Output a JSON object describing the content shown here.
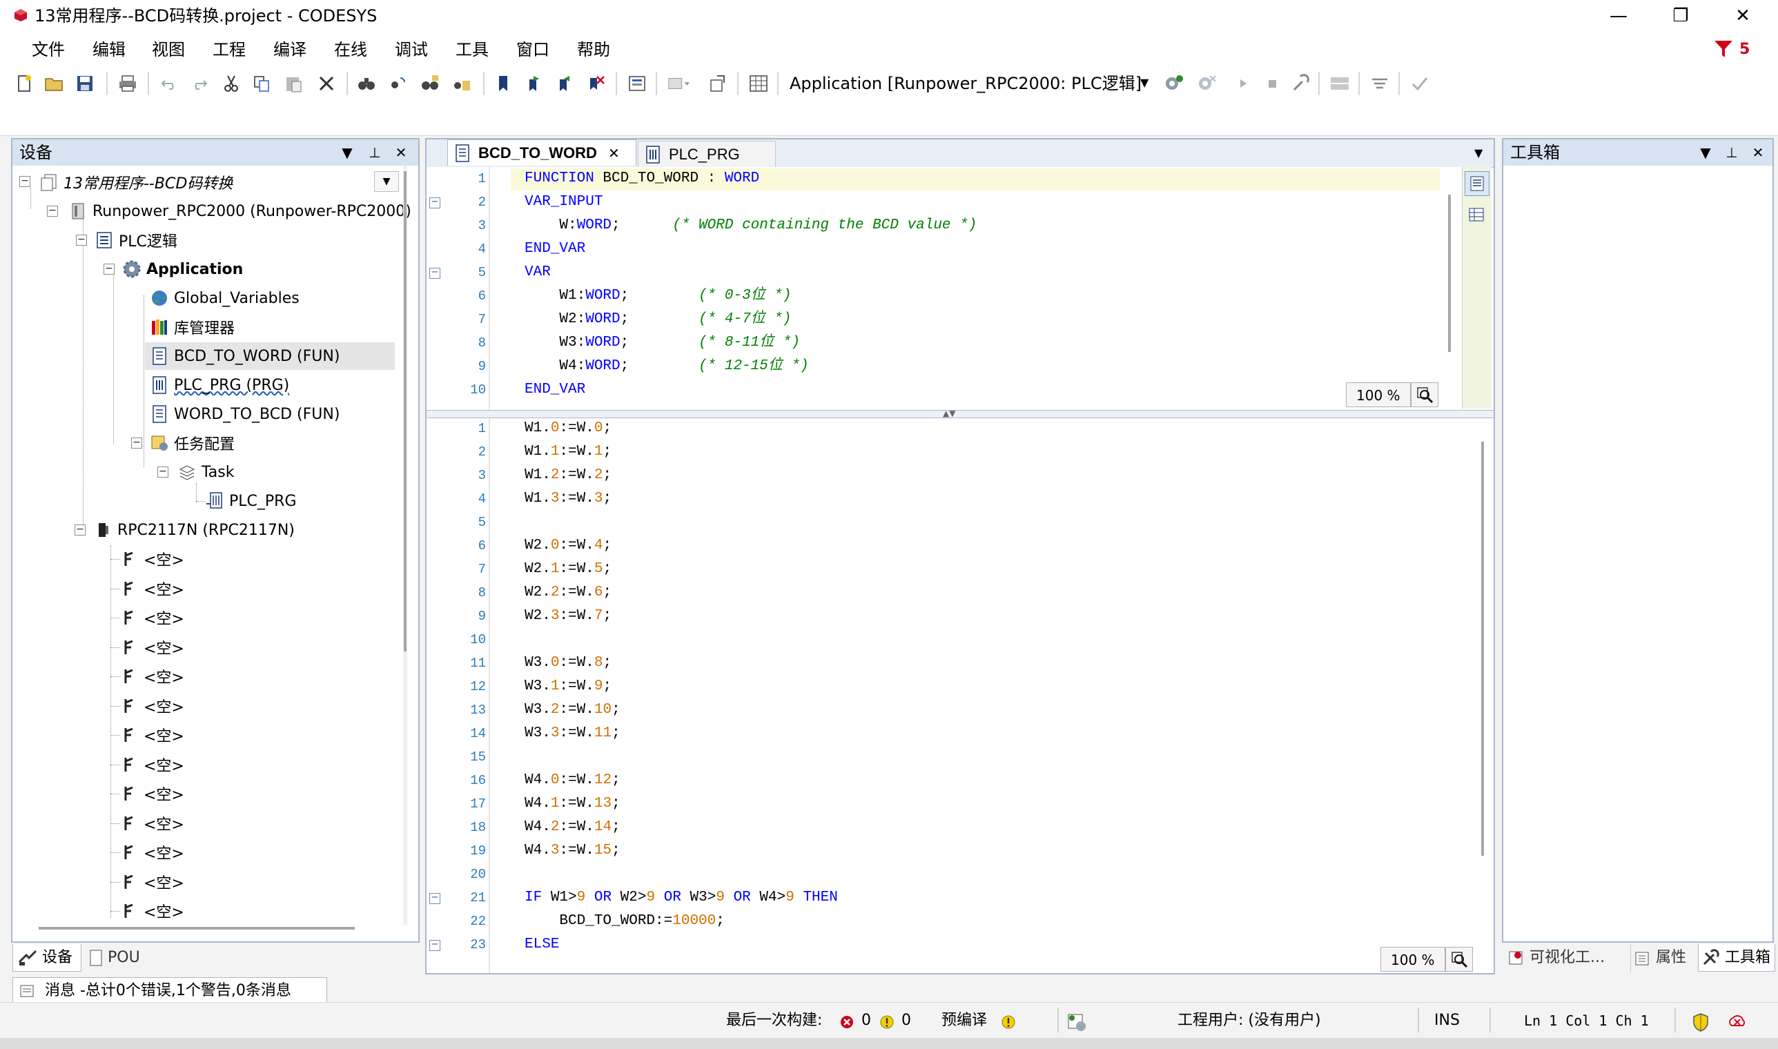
{
  "window": {
    "title": "13常用程序--BCD码转换.project - CODESYS",
    "minimize": "—",
    "restore": "❐",
    "close": "✕",
    "notification_count": "5"
  },
  "menu": [
    "文件",
    "编辑",
    "视图",
    "工程",
    "编译",
    "在线",
    "调试",
    "工具",
    "窗口",
    "帮助"
  ],
  "toolbar": {
    "active_application": "Application [Runpower_RPC2000: PLC逻辑]"
  },
  "devices_panel": {
    "title": "设备",
    "tree": {
      "root": "13常用程序--BCD码转换",
      "device": "Runpower_RPC2000 (Runpower-RPC2000)",
      "plc_logic": "PLC逻辑",
      "application": "Application",
      "global_variables": "Global_Variables",
      "library_manager": "库管理器",
      "bcd_to_word": "BCD_TO_WORD (FUN)",
      "plc_prg": "PLC_PRG (PRG)",
      "word_to_bcd": "WORD_TO_BCD (FUN)",
      "task_config": "任务配置",
      "task": "Task",
      "task_plc_prg": "PLC_PRG",
      "module": "RPC2117N (RPC2117N)",
      "empty_slot_label": "<空>",
      "empty_slot_count": 13
    },
    "bottom_tabs": [
      "设备",
      "POU"
    ]
  },
  "editor": {
    "tabs": [
      "BCD_TO_WORD",
      "PLC_PRG"
    ],
    "declaration_zoom": "100 %",
    "body_zoom": "100 %"
  },
  "toolbox_panel": {
    "title": "工具箱",
    "bottom_tabs": [
      "可视化工...",
      "属性",
      "工具箱"
    ]
  },
  "messages_tab": "消息 -总计0个错误,1个警告,0条消息",
  "statusbar": {
    "last_build_label": "最后一次构建:",
    "errors": "0",
    "warnings": "0",
    "precompile_label": "预编译",
    "project_user": "工程用户: (没有用户)",
    "ins": "INS",
    "position": "Ln 1  Col 1  Ch 1"
  },
  "colors": {
    "keyword": "#0000ff",
    "number": "#d07000",
    "comment": "#008000",
    "line_number": "#2b7bb9",
    "panel_header": "#d8e3f1"
  }
}
